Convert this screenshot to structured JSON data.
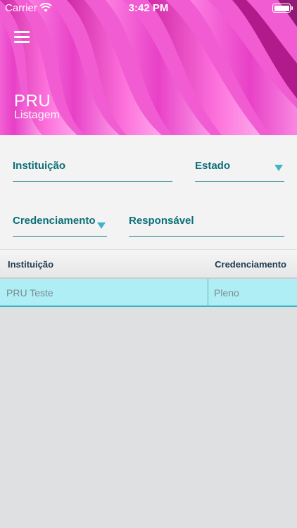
{
  "status_bar": {
    "carrier": "Carrier",
    "time": "3:42 PM"
  },
  "header": {
    "title": "PRU",
    "subtitle": "Listagem",
    "menu_icon": "hamburger-menu-icon",
    "background_color": "#ff6ad8"
  },
  "filters": {
    "instituicao_label": "Instituição",
    "estado_label": "Estado",
    "credenciamento_label": "Credenciamento",
    "responsavel_label": "Responsável",
    "accent_color": "#0d6e78"
  },
  "table": {
    "headers": [
      "Instituição",
      "Credenciamento"
    ],
    "rows": [
      [
        "PRU Teste",
        "Pleno"
      ]
    ],
    "selected_row_color": "#aeeef4"
  }
}
